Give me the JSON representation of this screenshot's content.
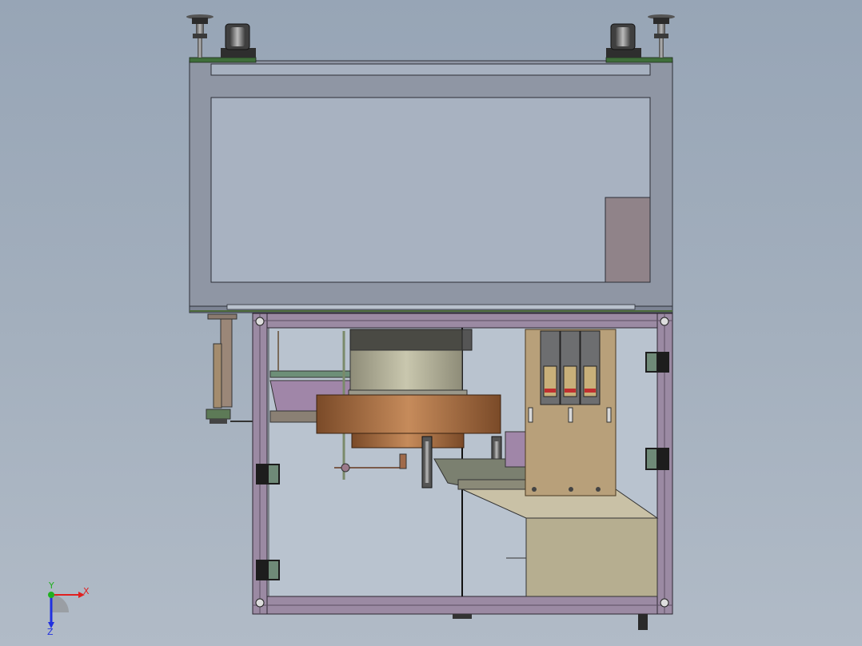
{
  "viewport": {
    "background_top": "#97a5b6",
    "background_bottom": "#b1bbc7"
  },
  "model": {
    "frame_color": "#8c94a3",
    "profile_color": "#9b8aa3",
    "cabinet_panel_color": "#b8aa7a",
    "motor_color": "#b8794a",
    "breaker_color": "#6d6e70",
    "breaker_count": 3,
    "hinge_count": 5,
    "caster_count": 2
  },
  "triad": {
    "x_label": "X",
    "y_label": "Y",
    "z_label": "Z",
    "x_color": "#e02020",
    "y_color": "#20b020",
    "z_color": "#2030e0"
  }
}
